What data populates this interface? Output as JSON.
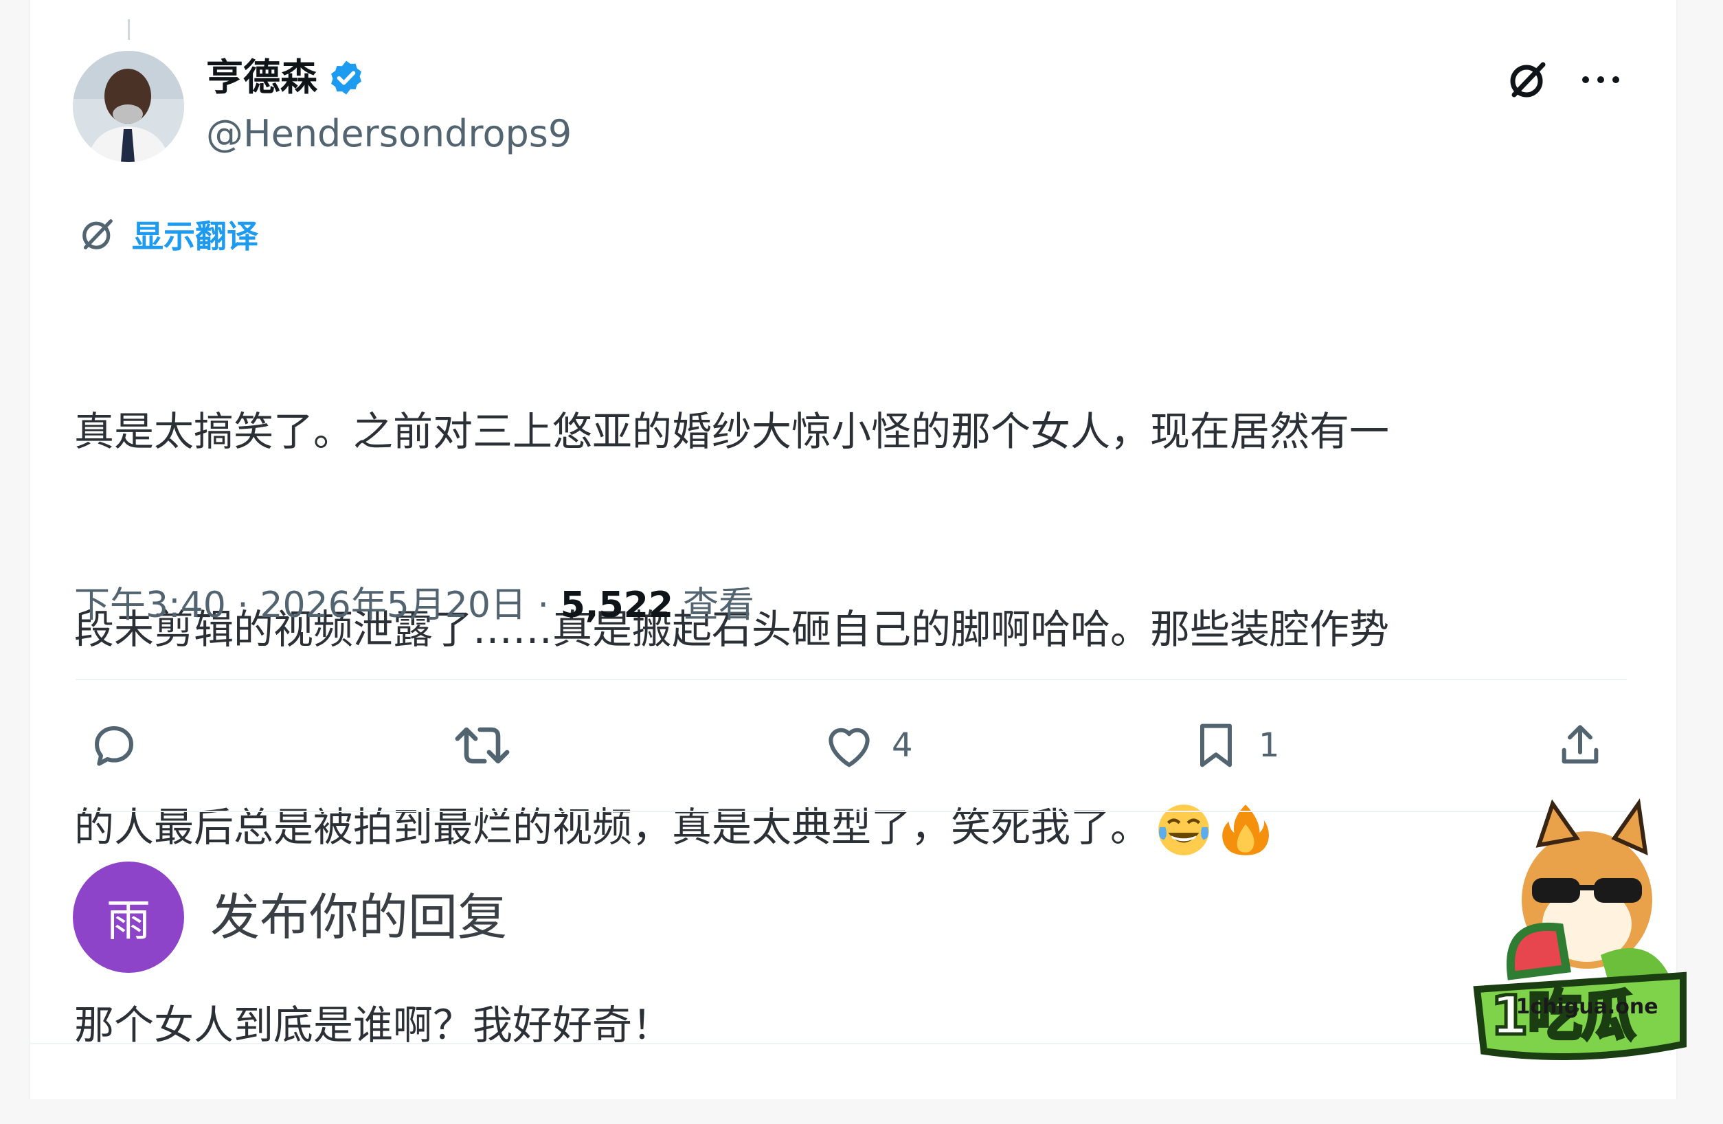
{
  "author": {
    "display_name": "亨德森",
    "handle": "@Hendersondrops9",
    "verified": true
  },
  "translate": {
    "label": "显示翻译"
  },
  "tweet": {
    "text_lines": [
      "真是太搞笑了。之前对三上悠亚的婚纱大惊小怪的那个女人，现在居然有一",
      "段未剪辑的视频泄露了……真是搬起石头砸自己的脚啊哈哈。那些装腔作势",
      "的人最后总是被拍到最烂的视频，真是太典型了，笑死我了。",
      "那个女人到底是谁啊？我好好奇！"
    ],
    "emojis": [
      "face-with-tears-of-joy",
      "fire"
    ]
  },
  "meta": {
    "time": "下午3:40",
    "separator": " · ",
    "date": "2026年5月20日",
    "separator2": " · ",
    "views": "5,522",
    "views_label": "查看"
  },
  "actions": {
    "reply_count": "",
    "retweet_count": "",
    "like_count": "4",
    "bookmark_count": "1"
  },
  "reply_box": {
    "avatar_letter": "雨",
    "placeholder": "发布你的回复"
  },
  "watermark": {
    "text": "1chigua.one",
    "logo_text": "1吃瓜"
  },
  "colors": {
    "accent": "#1d9bf0",
    "muted": "#536471",
    "reply_avatar": "#8e44c8"
  }
}
